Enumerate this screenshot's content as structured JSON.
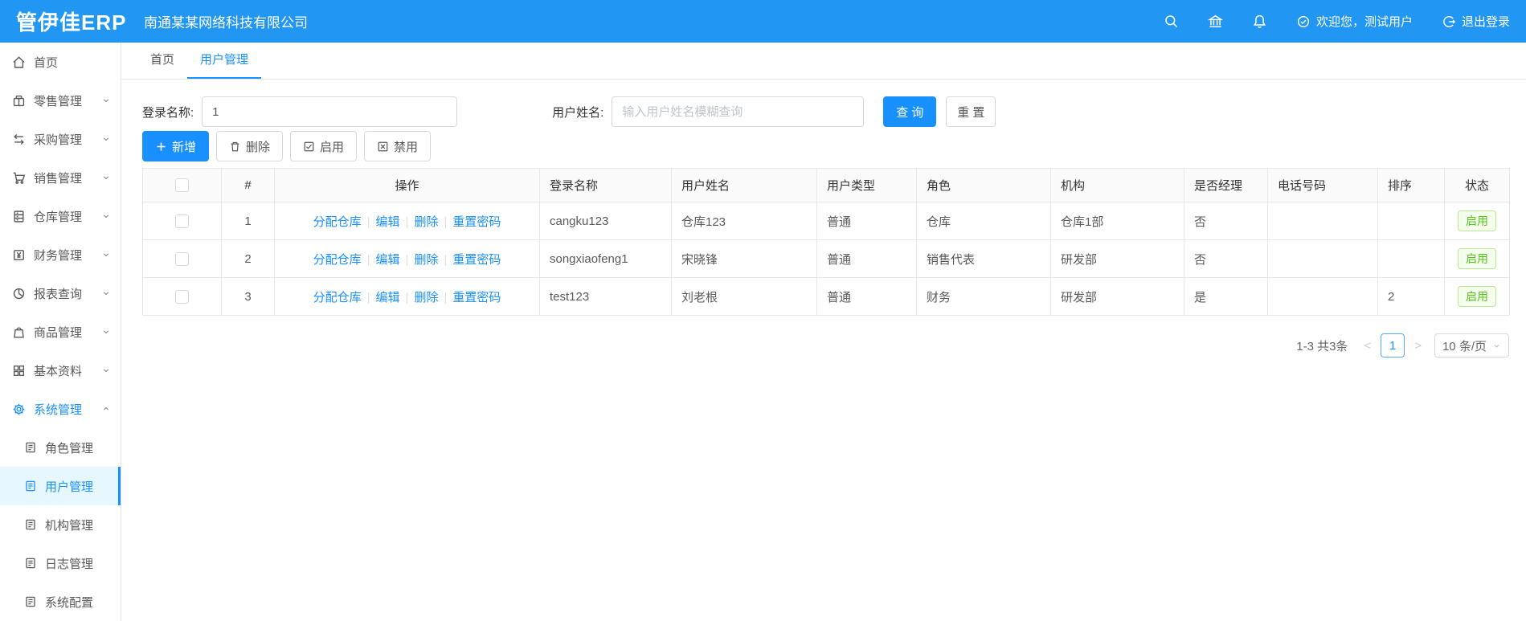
{
  "brand": {
    "logo": "管伊佳ERP",
    "company": "南通某某网络科技有限公司"
  },
  "topbar": {
    "welcome": "欢迎您，测试用户",
    "logout": "退出登录"
  },
  "colors": {
    "header_blue": "#2196f3",
    "primary": "#1890ff",
    "link": "#1890ff",
    "status_green": "#52c41a"
  },
  "sidebar": {
    "items": [
      {
        "label": "首页",
        "icon": "home-icon"
      },
      {
        "label": "零售管理",
        "icon": "retail-icon"
      },
      {
        "label": "采购管理",
        "icon": "purchase-icon"
      },
      {
        "label": "销售管理",
        "icon": "sales-cart-icon"
      },
      {
        "label": "仓库管理",
        "icon": "warehouse-icon"
      },
      {
        "label": "财务管理",
        "icon": "finance-icon"
      },
      {
        "label": "报表查询",
        "icon": "report-pie-icon"
      },
      {
        "label": "商品管理",
        "icon": "goods-bag-icon"
      },
      {
        "label": "基本资料",
        "icon": "basic-grid-icon"
      },
      {
        "label": "系统管理",
        "icon": "system-gear-icon"
      }
    ],
    "submenu": [
      {
        "label": "角色管理"
      },
      {
        "label": "用户管理"
      },
      {
        "label": "机构管理"
      },
      {
        "label": "日志管理"
      },
      {
        "label": "系统配置"
      }
    ]
  },
  "tabs": [
    {
      "label": "首页"
    },
    {
      "label": "用户管理"
    }
  ],
  "search": {
    "login_label": "登录名称:",
    "login_value": "1",
    "name_label": "用户姓名:",
    "name_placeholder": "输入用户姓名模糊查询",
    "query_btn": "查 询",
    "reset_btn": "重 置"
  },
  "toolbar": {
    "add": "新增",
    "remove": "删除",
    "enable": "启用",
    "disable": "禁用"
  },
  "table": {
    "columns": [
      "",
      "#",
      "操作",
      "登录名称",
      "用户姓名",
      "用户类型",
      "角色",
      "机构",
      "是否经理",
      "电话号码",
      "排序",
      "状态"
    ],
    "action_labels": [
      "分配仓库",
      "编辑",
      "删除",
      "重置密码"
    ],
    "action_names": [
      "assign-warehouse",
      "edit",
      "delete",
      "reset-password"
    ],
    "rows": [
      {
        "index": "1",
        "login_name": "cangku123",
        "user_name": "仓库123",
        "user_type": "普通",
        "role": "仓库",
        "org": "仓库1部",
        "is_manager": "否",
        "phone": "",
        "sort": "",
        "status": "启用"
      },
      {
        "index": "2",
        "login_name": "songxiaofeng1",
        "user_name": "宋晓锋",
        "user_type": "普通",
        "role": "销售代表",
        "org": "研发部",
        "is_manager": "否",
        "phone": "",
        "sort": "",
        "status": "启用"
      },
      {
        "index": "3",
        "login_name": "test123",
        "user_name": "刘老根",
        "user_type": "普通",
        "role": "财务",
        "org": "研发部",
        "is_manager": "是",
        "phone": "",
        "sort": "2",
        "status": "启用"
      }
    ]
  },
  "pagination": {
    "total": "1-3 共3条",
    "prev": "<",
    "page": "1",
    "next": ">",
    "size": "10 条/页"
  }
}
